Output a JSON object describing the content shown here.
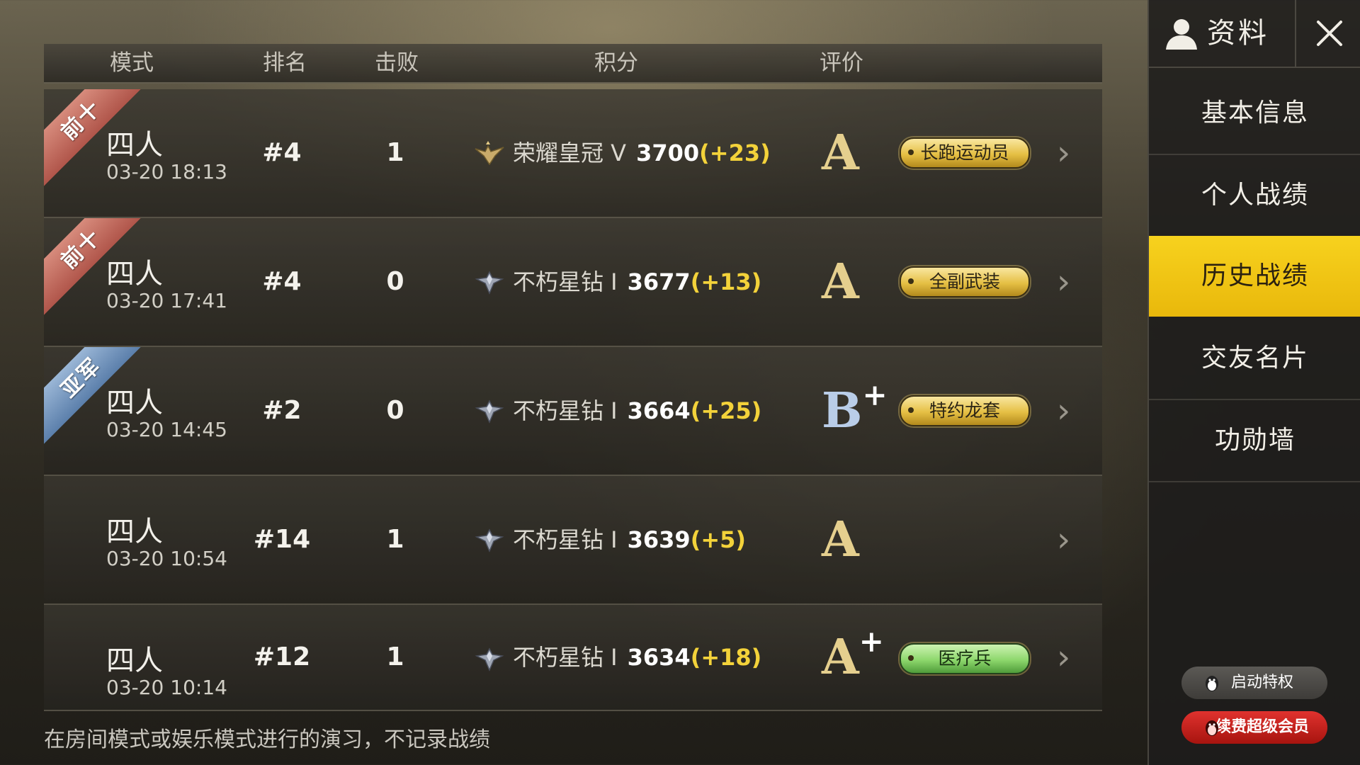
{
  "header": {
    "mode": "模式",
    "rank": "排名",
    "kills": "击败",
    "score": "积分",
    "rating": "评价"
  },
  "matches": [
    {
      "ribbon": "前十",
      "ribbon_color": "#c0645a",
      "mode": "四人",
      "time": "03-20 18:13",
      "rank": "#4",
      "kills": "1",
      "tier_icon": "crown-wings-icon",
      "tier": "荣耀皇冠 V",
      "points": "3700",
      "delta": "(+23)",
      "grade": "A",
      "grade_plus": "",
      "badge": "长跑运动员",
      "badge_color": "gold"
    },
    {
      "ribbon": "前十",
      "ribbon_color": "#c0645a",
      "mode": "四人",
      "time": "03-20 17:41",
      "rank": "#4",
      "kills": "0",
      "tier_icon": "diamond-wings-icon",
      "tier": "不朽星钻 I",
      "points": "3677",
      "delta": "(+13)",
      "grade": "A",
      "grade_plus": "",
      "badge": "全副武装",
      "badge_color": "gold"
    },
    {
      "ribbon": "亚军",
      "ribbon_color": "#6d8fb9",
      "mode": "四人",
      "time": "03-20 14:45",
      "rank": "#2",
      "kills": "0",
      "tier_icon": "diamond-wings-icon",
      "tier": "不朽星钻 I",
      "points": "3664",
      "delta": "(+25)",
      "grade": "B",
      "grade_plus": "+",
      "badge": "特约龙套",
      "badge_color": "gold"
    },
    {
      "ribbon": "",
      "ribbon_color": "",
      "mode": "四人",
      "time": "03-20 10:54",
      "rank": "#14",
      "kills": "1",
      "tier_icon": "diamond-wings-icon",
      "tier": "不朽星钻 I",
      "points": "3639",
      "delta": "(+5)",
      "grade": "A",
      "grade_plus": "",
      "badge": "",
      "badge_color": ""
    },
    {
      "ribbon": "",
      "ribbon_color": "",
      "mode": "四人",
      "time": "03-20 10:14",
      "rank": "#12",
      "kills": "1",
      "tier_icon": "diamond-wings-icon",
      "tier": "不朽星钻 I",
      "points": "3634",
      "delta": "(+18)",
      "grade": "A",
      "grade_plus": "+",
      "badge": "医疗兵",
      "badge_color": "green"
    }
  ],
  "notice": "在房间模式或娱乐模式进行的演习，不记录战绩",
  "sidebar": {
    "title": "资料",
    "title_icon": "person-icon",
    "close_icon": "close-icon",
    "items": [
      {
        "label": "基本信息",
        "active": false
      },
      {
        "label": "个人战绩",
        "active": false
      },
      {
        "label": "历史战绩",
        "active": true
      },
      {
        "label": "交友名片",
        "active": false
      },
      {
        "label": "功勋墙",
        "active": false
      }
    ],
    "privilege_button": "启动特权",
    "renew_button": "续费超级会员"
  },
  "colors": {
    "accent_yellow": "#f3d23a",
    "active_menu": "#f0c414",
    "renew_red": "#c91f1a"
  }
}
